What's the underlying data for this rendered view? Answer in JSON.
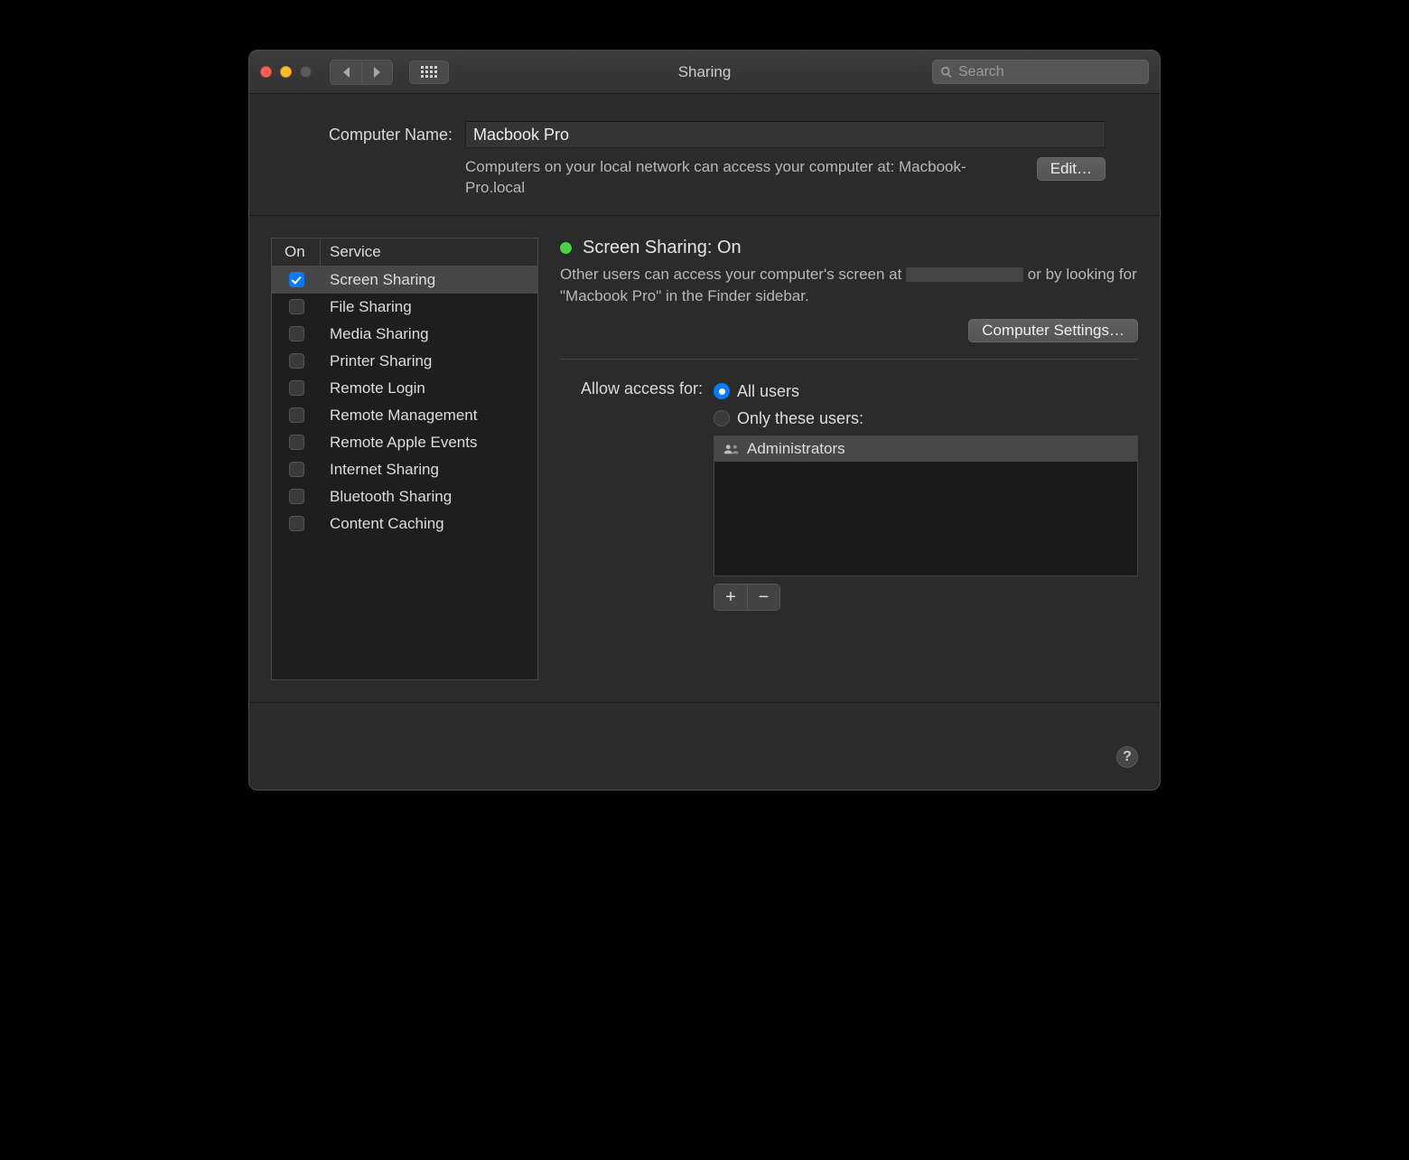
{
  "toolbar": {
    "title": "Sharing",
    "search_placeholder": "Search"
  },
  "computer": {
    "label": "Computer Name:",
    "value": "Macbook Pro",
    "description": "Computers on your local network can access your computer at: Macbook-Pro.local",
    "edit_button": "Edit…"
  },
  "service_list": {
    "header_on": "On",
    "header_service": "Service",
    "items": [
      {
        "on": true,
        "name": "Screen Sharing",
        "selected": true
      },
      {
        "on": false,
        "name": "File Sharing"
      },
      {
        "on": false,
        "name": "Media Sharing"
      },
      {
        "on": false,
        "name": "Printer Sharing"
      },
      {
        "on": false,
        "name": "Remote Login"
      },
      {
        "on": false,
        "name": "Remote Management"
      },
      {
        "on": false,
        "name": "Remote Apple Events"
      },
      {
        "on": false,
        "name": "Internet Sharing"
      },
      {
        "on": false,
        "name": "Bluetooth Sharing"
      },
      {
        "on": false,
        "name": "Content Caching"
      }
    ]
  },
  "detail": {
    "status_title": "Screen Sharing: On",
    "status_desc_before": "Other users can access your computer's screen at ",
    "status_desc_after": " or by looking for \"Macbook Pro\" in the Finder sidebar.",
    "computer_settings_button": "Computer Settings…",
    "access_label": "Allow access for:",
    "radio_all": "All users",
    "radio_only": "Only these users:",
    "radio_selected": "all",
    "users": [
      "Administrators"
    ],
    "plus": "+",
    "minus": "−"
  },
  "help": "?"
}
